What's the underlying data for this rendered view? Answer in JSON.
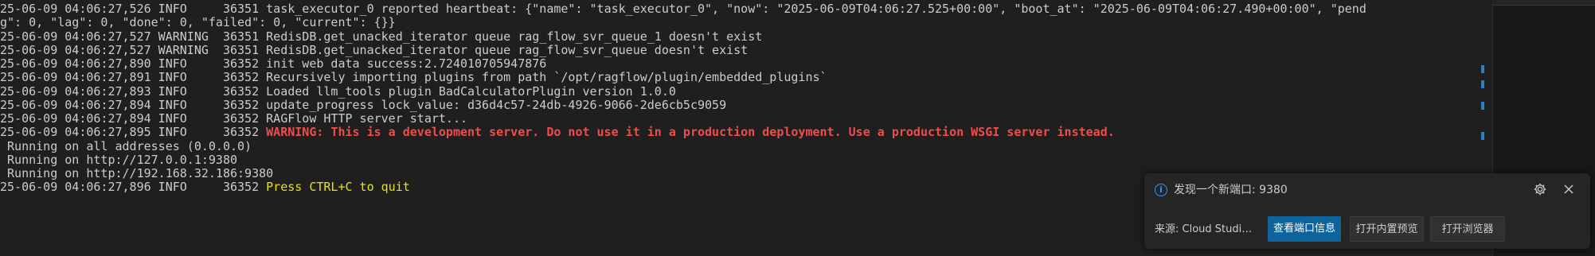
{
  "terminal": {
    "lines": [
      {
        "text": "25-06-09 04:06:27,526 INFO     36351 task_executor_0 reported heartbeat: {\"name\": \"task_executor_0\", \"now\": \"2025-06-09T04:06:27.525+00:00\", \"boot_at\": \"2025-06-09T04:06:27.490+00:00\", \"pend"
      },
      {
        "text": "g\": 0, \"lag\": 0, \"done\": 0, \"failed\": 0, \"current\": {}}"
      },
      {
        "text": "25-06-09 04:06:27,527 WARNING  36351 RedisDB.get_unacked_iterator queue rag_flow_svr_queue_1 doesn't exist"
      },
      {
        "text": "25-06-09 04:06:27,527 WARNING  36351 RedisDB.get_unacked_iterator queue rag_flow_svr_queue doesn't exist"
      },
      {
        "text": "25-06-09 04:06:27,890 INFO     36352 init web data success:2.724010705947876"
      },
      {
        "text": "25-06-09 04:06:27,891 INFO     36352 Recursively importing plugins from path `/opt/ragflow/plugin/embedded_plugins`"
      },
      {
        "text": "25-06-09 04:06:27,893 INFO     36352 Loaded llm_tools plugin BadCalculatorPlugin version 1.0.0"
      },
      {
        "text": "25-06-09 04:06:27,894 INFO     36352 update_progress lock_value: d36d4c57-24db-4926-9066-2de6cb5c9059"
      },
      {
        "text": "25-06-09 04:06:27,894 INFO     36352 RAGFlow HTTP server start..."
      },
      {
        "text": "25-06-09 04:06:27,895 INFO     36352 ",
        "highlight": "WARNING: This is a development server. Do not use it in a production deployment. Use a production WSGI server instead.",
        "kind": "warn"
      },
      {
        "text": " Running on all addresses (0.0.0.0)"
      },
      {
        "text": " Running on http://127.0.0.1:9380"
      },
      {
        "text": " Running on http://192.168.32.186:9380"
      },
      {
        "text": "25-06-09 04:06:27,896 INFO     36352 ",
        "highlight": "Press CTRL+C to quit",
        "kind": "yellow"
      }
    ]
  },
  "notification": {
    "message": "发现一个新端口: 9380",
    "source": "来源: Cloud Studio Bro...",
    "buttons": {
      "view_port_info": "查看端口信息",
      "open_builtin_preview": "打开内置预览",
      "open_browser": "打开浏览器"
    }
  },
  "icons": {
    "info": "info-icon",
    "gear": "gear-icon",
    "close": "close-icon"
  },
  "colors": {
    "background": "#1f1f1f",
    "text": "#cccccc",
    "warning_red": "#f14c4c",
    "yellow": "#e5e510",
    "primary_button": "#0e639c",
    "info_blue": "#3794ff"
  }
}
